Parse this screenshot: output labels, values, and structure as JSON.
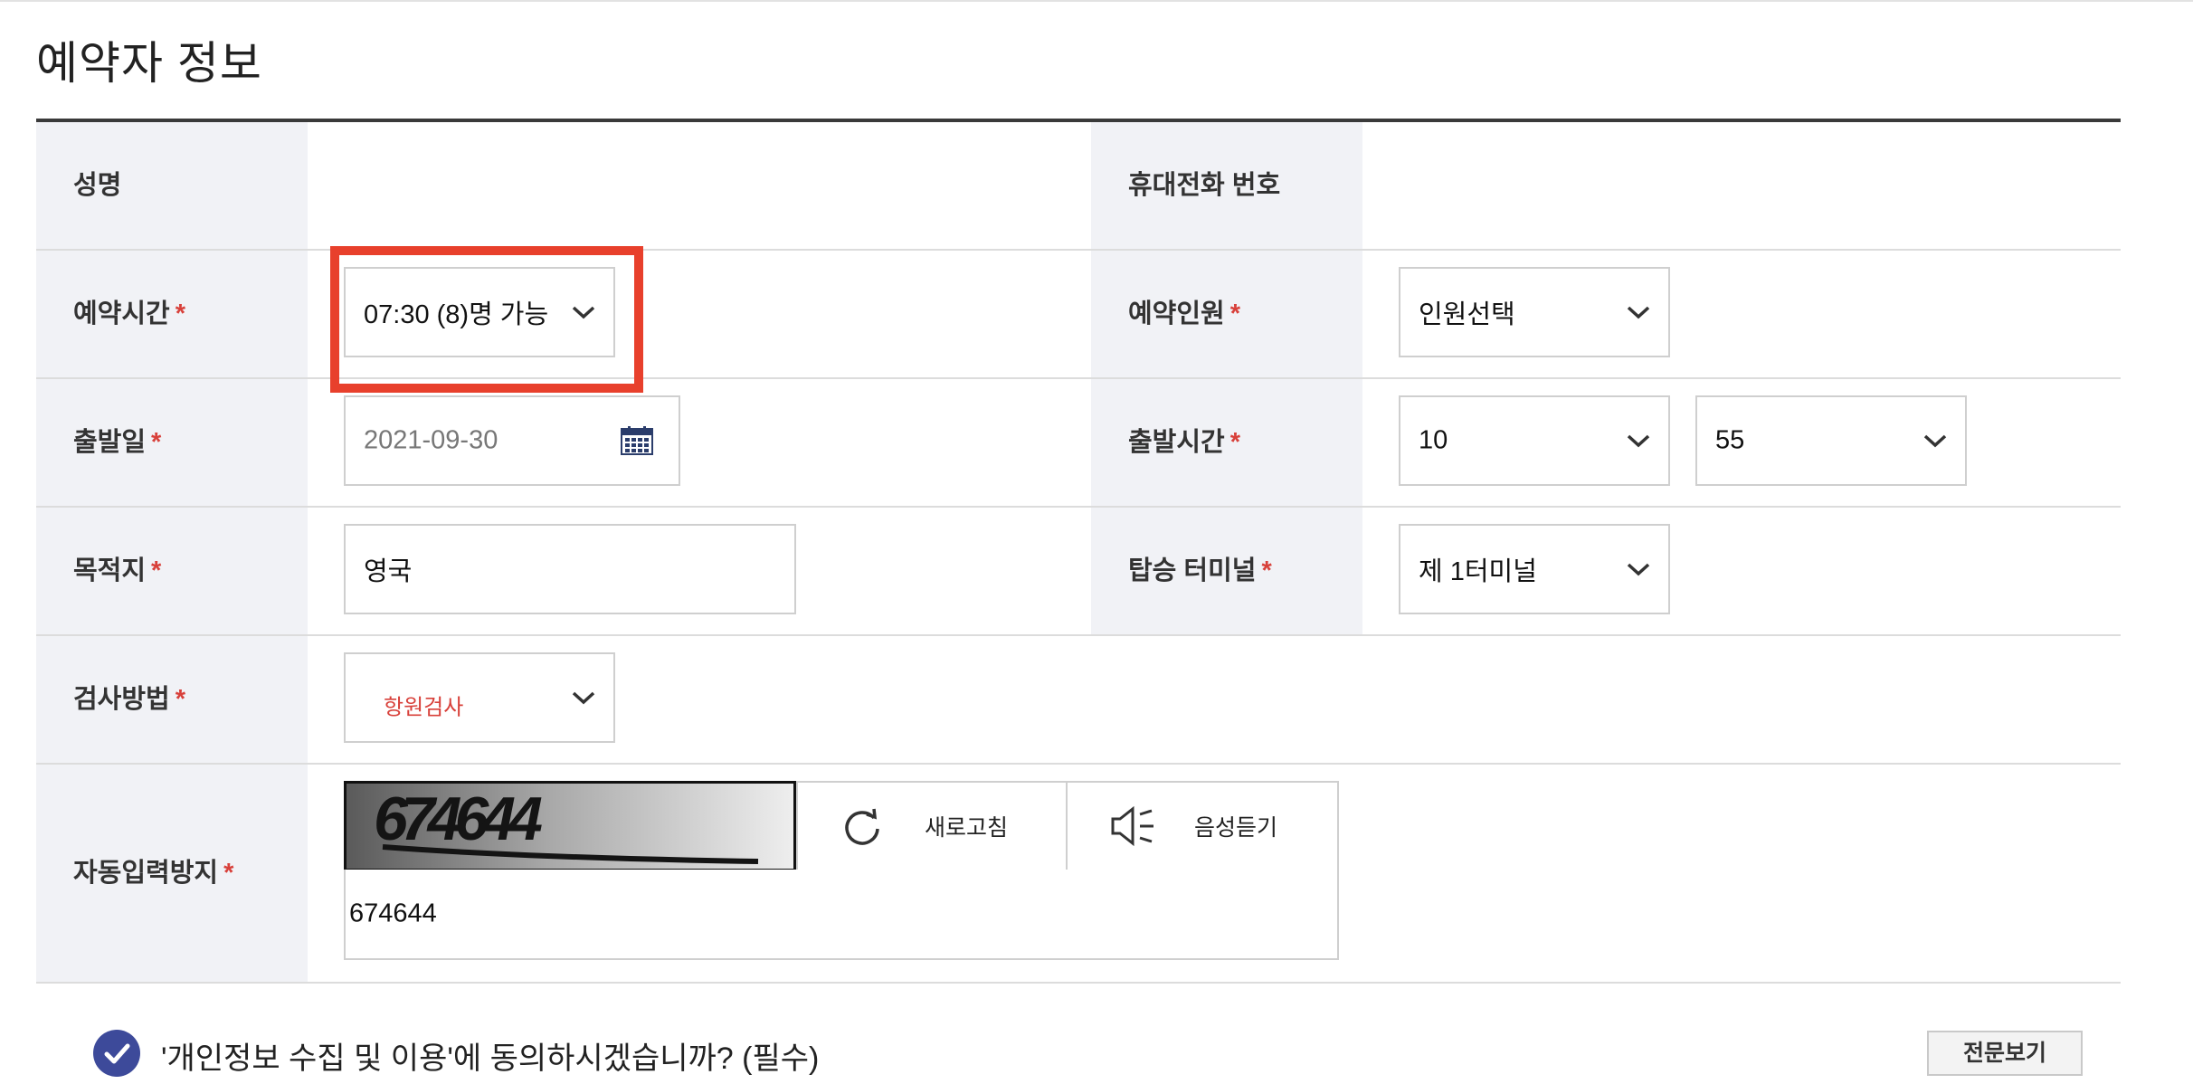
{
  "page_title": "예약자 정보",
  "required_mark": "*",
  "name_row": {
    "label": "성명",
    "phone_label": "휴대전화 번호"
  },
  "reservation_time": {
    "label": "예약시간",
    "value": "07:30 (8)명 가능"
  },
  "party_size": {
    "label": "예약인원",
    "value": "인원선택"
  },
  "departure_date": {
    "label": "출발일",
    "value": "2021-09-30"
  },
  "departure_time": {
    "label": "출발시간",
    "hour": "10",
    "minute": "55"
  },
  "destination": {
    "label": "목적지",
    "value": "영국"
  },
  "terminal": {
    "label": "탑승 터미널",
    "value": "제 1터미널"
  },
  "test_method": {
    "label": "검사방법",
    "value": "항원검사"
  },
  "captcha": {
    "label": "자동입력방지",
    "image_text": "674644",
    "refresh_label": "새로고침",
    "audio_label": "음성듣기",
    "input_value": "674644"
  },
  "consent": {
    "text": "'개인정보 수집 및 이용'에 동의하시겠습니까? (필수)",
    "button_label": "전문보기"
  },
  "colors": {
    "accent_red": "#e8402c",
    "required_red": "#d8403a",
    "check_blue": "#3d4a9a",
    "label_bg": "#f1f2f6"
  }
}
